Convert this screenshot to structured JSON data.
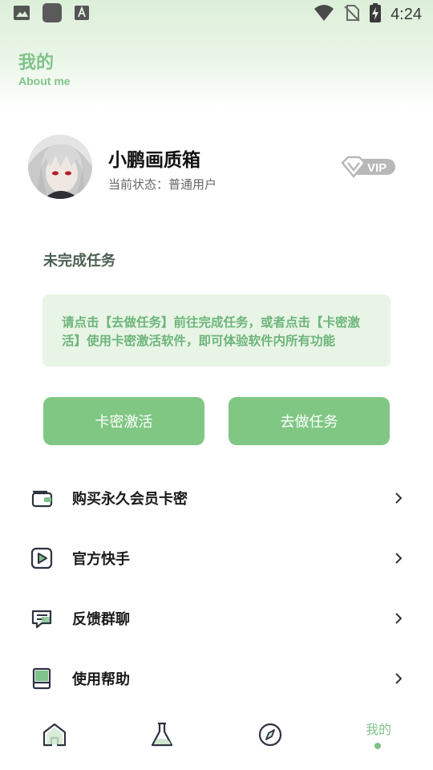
{
  "status_bar": {
    "time": "4:24",
    "icons": [
      "image-icon",
      "app-square-icon",
      "font-a-icon",
      "wifi-icon",
      "no-sim-icon",
      "battery-charging-icon"
    ]
  },
  "header": {
    "title": "我的",
    "subtitle": "About me"
  },
  "profile": {
    "name": "小鹏画质箱",
    "status": "当前状态：普通用户",
    "badge": "VIP"
  },
  "tasks": {
    "title": "未完成任务",
    "notice": "请点击【去做任务】前往完成任务，或者点击【卡密激活】使用卡密激活软件，即可体验软件内所有功能",
    "activate_label": "卡密激活",
    "do_task_label": "去做任务"
  },
  "menu": [
    {
      "label": "购买永久会员卡密",
      "icon": "wallet-icon"
    },
    {
      "label": "官方快手",
      "icon": "video-play-icon"
    },
    {
      "label": "反馈群聊",
      "icon": "chat-icon"
    },
    {
      "label": "使用帮助",
      "icon": "book-icon"
    }
  ],
  "bottom_nav": {
    "items": [
      "home-icon",
      "flask-icon",
      "compass-icon"
    ],
    "active_label": "我的"
  },
  "colors": {
    "accent": "#80c784",
    "accent_text": "#7fc38a",
    "notice_bg": "#e8f4e6"
  }
}
